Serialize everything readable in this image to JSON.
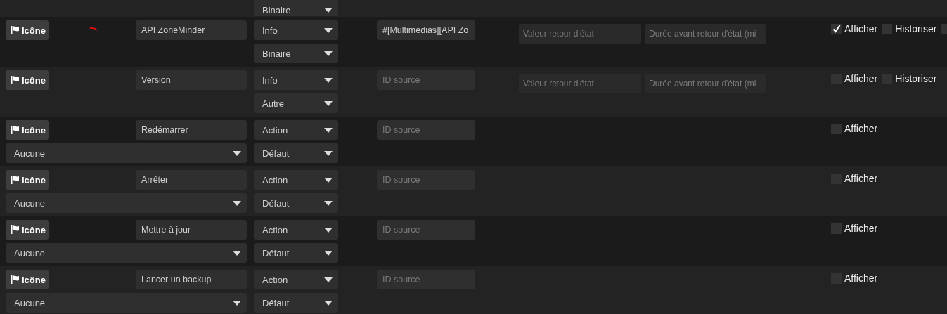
{
  "top_row": {
    "subtype": "Binaire"
  },
  "rows": [
    {
      "icon_button": "Icône",
      "marker": true,
      "name": "API ZoneMinder",
      "type": "Info",
      "subtype": "Binaire",
      "source": {
        "value": "#[Multimédias][API Zo"
      },
      "state_fields": [
        {
          "placeholder": "Valeur retour d'état"
        },
        {
          "placeholder": "Durée avant retour d'état (mi"
        }
      ],
      "checkboxes": [
        {
          "label": "Afficher",
          "checked": true
        },
        {
          "label": "Historiser",
          "checked": false
        },
        {
          "checked": false
        }
      ]
    },
    {
      "icon_button": "Icône",
      "marker": false,
      "name": "Version",
      "type": "Info",
      "subtype": "Autre",
      "source": {
        "placeholder": "ID source"
      },
      "state_fields": [
        {
          "placeholder": "Valeur retour d'état"
        },
        {
          "placeholder": "Durée avant retour d'état (mi"
        }
      ],
      "checkboxes": [
        {
          "label": "Afficher",
          "checked": false
        },
        {
          "label": "Historiser",
          "checked": false
        }
      ]
    },
    {
      "icon_button": "Icône",
      "marker": false,
      "name": "Redémarrer",
      "type": "Action",
      "subtype": "Défaut",
      "generic_type": "Aucune",
      "source": {
        "placeholder": "ID source"
      },
      "checkboxes": [
        {
          "label": "Afficher",
          "checked": false
        }
      ]
    },
    {
      "icon_button": "Icône",
      "marker": false,
      "name": "Arrêter",
      "type": "Action",
      "subtype": "Défaut",
      "generic_type": "Aucune",
      "source": {
        "placeholder": "ID source"
      },
      "checkboxes": [
        {
          "label": "Afficher",
          "checked": false
        }
      ]
    },
    {
      "icon_button": "Icône",
      "marker": false,
      "name": "Mettre à jour",
      "type": "Action",
      "subtype": "Défaut",
      "generic_type": "Aucune",
      "source": {
        "placeholder": "ID source"
      },
      "checkboxes": [
        {
          "label": "Afficher",
          "checked": false
        }
      ]
    },
    {
      "icon_button": "Icône",
      "marker": false,
      "name": "Lancer un backup",
      "type": "Action",
      "subtype": "Défaut",
      "generic_type": "Aucune",
      "source": {
        "placeholder": "ID source"
      },
      "checkboxes": [
        {
          "label": "Afficher",
          "checked": false
        }
      ]
    }
  ]
}
